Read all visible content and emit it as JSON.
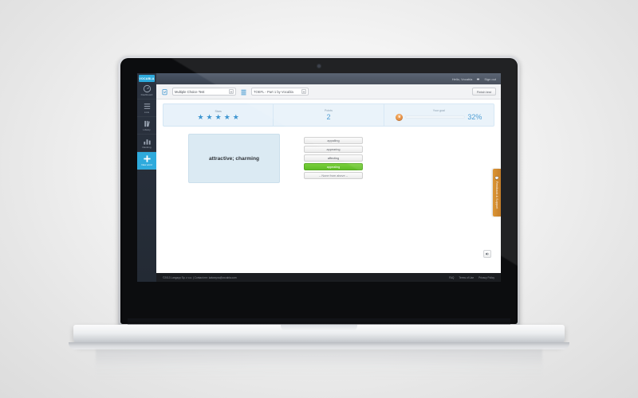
{
  "device": {
    "type": "laptop"
  },
  "sidebar": {
    "logo": "VOCABLA",
    "items": [
      {
        "label": "Dashboard",
        "icon": "gauge-icon",
        "active": false
      },
      {
        "label": "Lists",
        "icon": "list-icon",
        "active": false
      },
      {
        "label": "Library",
        "icon": "books-icon",
        "active": false
      },
      {
        "label": "Ranking",
        "icon": "bar-chart-icon",
        "active": false
      },
      {
        "label": "New word",
        "icon": "plus-icon",
        "active": true
      }
    ]
  },
  "topbar": {
    "greeting": "Hello, Vocabla",
    "settings_icon": "gear-icon",
    "signout": "Sign out"
  },
  "toolbar": {
    "test_icon": "clipboard-check-icon",
    "test_type": "Multiple Choice Test",
    "list_icon": "list-lines-icon",
    "test_name": "TOEFL - Part 1 by Vocabla",
    "finish_label": "Finish test"
  },
  "stats": {
    "stars": {
      "label": "Stars",
      "count": 5,
      "star_glyph": "★"
    },
    "points": {
      "label": "Points",
      "value": "2"
    },
    "goal": {
      "label": "Your goal",
      "percent": "32%",
      "percent_value": 32,
      "trophy_icon": "trophy-icon",
      "trophy_glyph": "Ἴ6"
    }
  },
  "quiz": {
    "prompt": "attractive; charming",
    "options": [
      {
        "text": "appalling",
        "state": "default"
      },
      {
        "text": "appearing",
        "state": "default"
      },
      {
        "text": "affecting",
        "state": "default"
      },
      {
        "text": "appealing",
        "state": "selected"
      },
      {
        "text": "-- None from above --",
        "state": "none"
      }
    ],
    "speaker_icon": "speaker-icon"
  },
  "feedback_tab": {
    "icon": "comment-icon",
    "label": "Feedback & Support"
  },
  "footer": {
    "copyright": "©2013 Langapp Sp. z o.o. | Contact me:  katarzyna@vocabla.com",
    "links": [
      "FAQ",
      "Terms of Use",
      "Privacy Policy"
    ]
  },
  "colors": {
    "sidebar": "#2b3340",
    "accent_blue": "#2eaadc",
    "stat_blue": "#3d95d0",
    "stats_bg": "#e8f2fa",
    "card_bg": "#dbeaf3",
    "selected_green": "#5fbd27",
    "feedback_orange": "#bf7316",
    "footer_dark": "#1b1d21"
  }
}
